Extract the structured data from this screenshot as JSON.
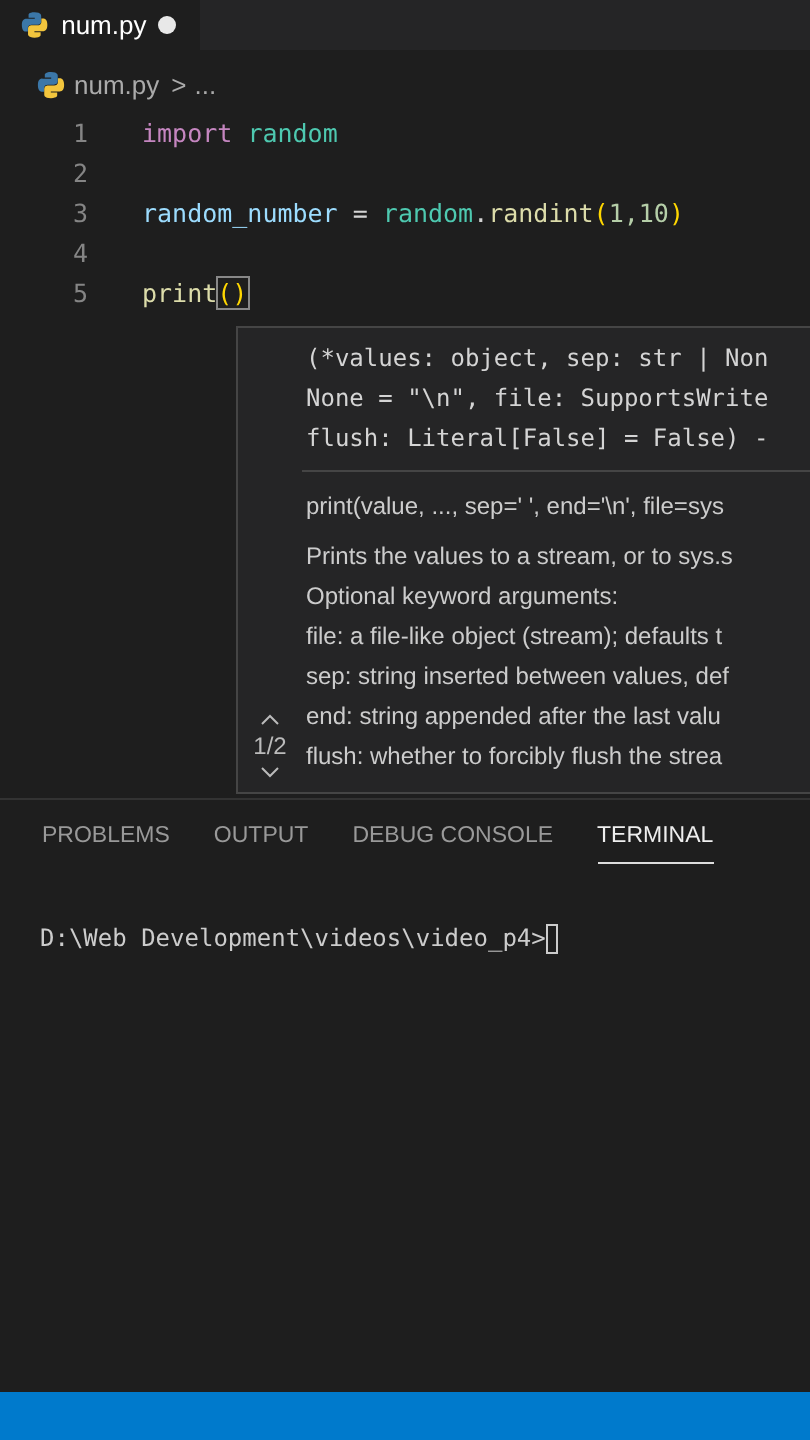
{
  "tabs": [
    {
      "label": "num.py",
      "selected": true,
      "modified": true
    }
  ],
  "breadcrumb": {
    "file": "num.py",
    "separator": ">",
    "rest": "..."
  },
  "code_lines": [
    {
      "number": "1",
      "tokens": [
        {
          "text": "import ",
          "kind": "keyword"
        },
        {
          "text": "random",
          "kind": "module"
        }
      ]
    },
    {
      "number": "2"
    },
    {
      "number": "3",
      "tokens": [
        {
          "text": "random_number",
          "kind": "variable"
        },
        {
          "text": " = "
        },
        {
          "text": "random",
          "kind": "module"
        },
        {
          "text": "."
        },
        {
          "text": "randint",
          "kind": "function"
        },
        {
          "text": "(",
          "kind": "paren"
        },
        {
          "text": "1,10",
          "kind": "number"
        },
        {
          "text": ")",
          "kind": "paren"
        }
      ]
    },
    {
      "number": "4"
    },
    {
      "number": "5",
      "tokens": [
        {
          "text": "print",
          "kind": "function"
        },
        {
          "text": "()",
          "kind": "paren-match"
        }
      ]
    }
  ],
  "hover": {
    "signature": [
      "(*values: object, sep: str | Non",
      "None = \"\\n\", file: SupportsWrite",
      "flush: Literal[False] = False) -"
    ],
    "usage": "print(value, ..., sep=' ', end='\\n', file=sys",
    "doc": [
      "Prints the values to a stream, or to sys.s",
      "Optional keyword arguments:",
      "file: a file-like object (stream); defaults t",
      "sep: string inserted between values, def",
      "end: string appended after the last valu",
      "flush: whether to forcibly flush the strea"
    ],
    "pager": "1/2"
  },
  "panel_tabs": [
    {
      "label": "PROBLEMS",
      "selected": false
    },
    {
      "label": "OUTPUT",
      "selected": false
    },
    {
      "label": "DEBUG CONSOLE",
      "selected": false
    },
    {
      "label": "TERMINAL",
      "selected": true
    }
  ],
  "terminal": {
    "prompt": "D:\\Web Development\\videos\\video_p4>"
  }
}
